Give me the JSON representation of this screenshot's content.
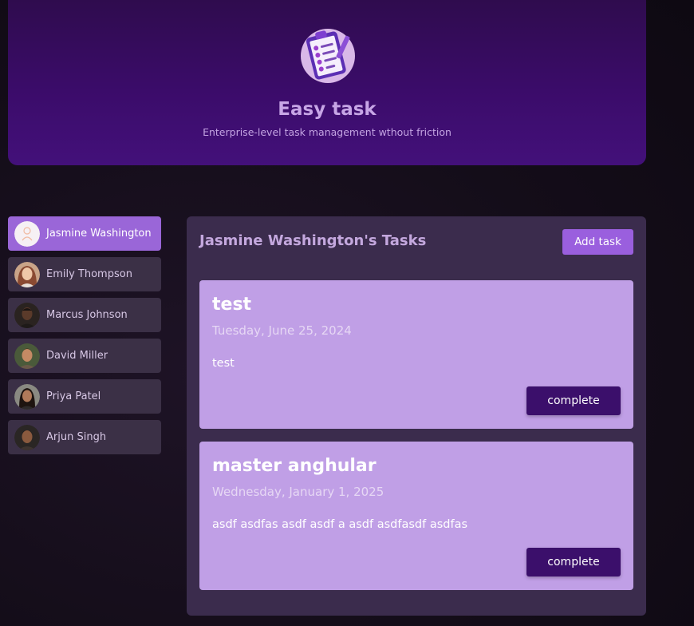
{
  "header": {
    "title": "Easy task",
    "subtitle": "Enterprise-level task management wthout friction",
    "logo_icon": "clipboard-checklist-icon"
  },
  "users": [
    {
      "name": "Jasmine Washington",
      "selected": true,
      "avatar_color": "#f6f0f4"
    },
    {
      "name": "Emily Thompson",
      "selected": false,
      "avatar_color": "#9a5a46"
    },
    {
      "name": "Marcus Johnson",
      "selected": false,
      "avatar_color": "#3a2a24"
    },
    {
      "name": "David Miller",
      "selected": false,
      "avatar_color": "#6e4b34"
    },
    {
      "name": "Priya Patel",
      "selected": false,
      "avatar_color": "#7a5242"
    },
    {
      "name": "Arjun Singh",
      "selected": false,
      "avatar_color": "#4a3428"
    }
  ],
  "tasks_panel": {
    "title": "Jasmine Washington's Tasks",
    "add_button_label": "Add task",
    "tasks": [
      {
        "title": "test",
        "date": "Tuesday, June 25, 2024",
        "description": "test",
        "action_label": "complete"
      },
      {
        "title": "master anghular",
        "date": "Wednesday, January 1, 2025",
        "description": "asdf asdfas asdf asdf a asdf asdfasdf asdfas",
        "action_label": "complete"
      }
    ]
  },
  "colors": {
    "accent": "#9a5fde",
    "header_bg": "#3b0c6a",
    "task_card": "#c09fe6",
    "complete_button": "#3b0f6b"
  }
}
